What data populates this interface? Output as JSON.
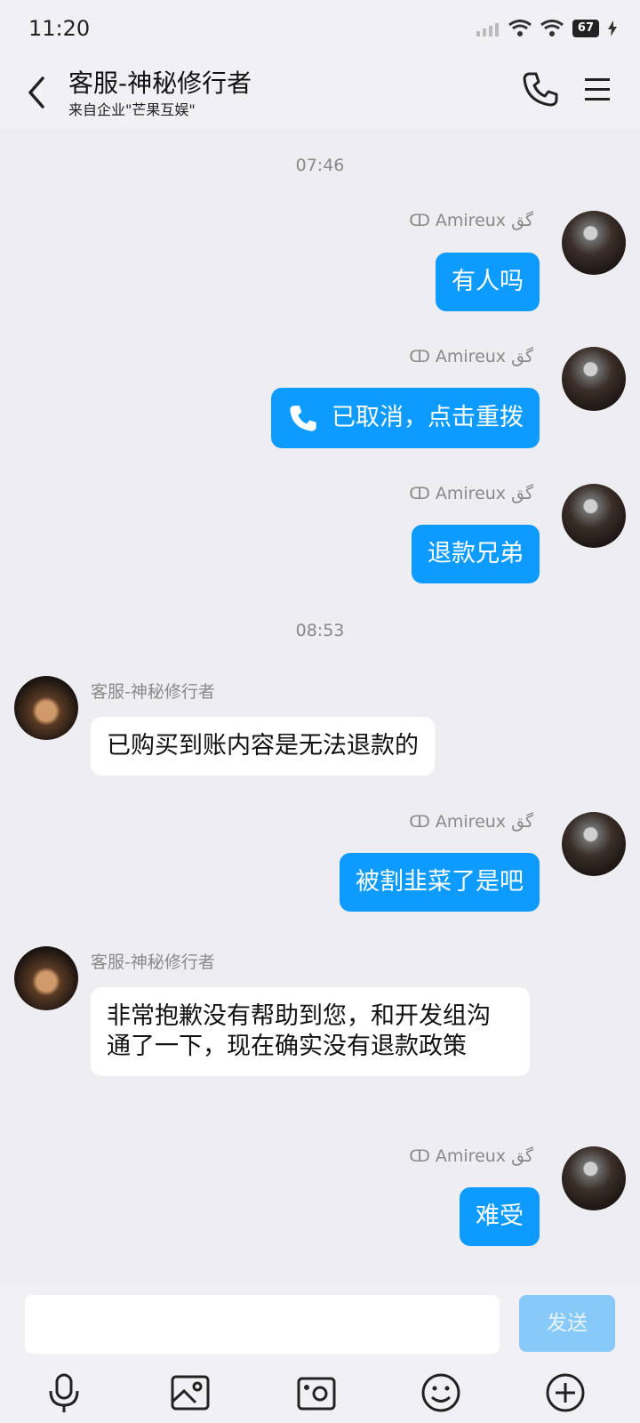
{
  "status_bar": {
    "time": "11:20",
    "battery": "67"
  },
  "header": {
    "title": "客服-神秘修行者",
    "subtitle": "来自企业\"芒果互娱\""
  },
  "timestamps": [
    "07:46",
    "08:53"
  ],
  "me_name": "ↀ Amireux گق",
  "agent_name": "客服-神秘修行者",
  "messages": [
    {
      "from": "me",
      "text": "有人吗"
    },
    {
      "from": "me",
      "text": "已取消，点击重拨",
      "type": "call"
    },
    {
      "from": "me",
      "text": "退款兄弟"
    },
    {
      "from": "agent",
      "text": "已购买到账内容是无法退款的"
    },
    {
      "from": "me",
      "text": "被割韭菜了是吧"
    },
    {
      "from": "agent",
      "text": "非常抱歉没有帮助到您，和开发组沟通了一下，现在确实没有退款政策"
    },
    {
      "from": "me",
      "text": "难受"
    }
  ],
  "input": {
    "value": "",
    "send_label": "发送"
  },
  "toolbar": [
    "microphone-icon",
    "image-icon",
    "camera-icon",
    "emoji-icon",
    "plus-icon"
  ],
  "colors": {
    "my_bubble": "#0e9bff",
    "their_bubble": "#ffffff",
    "background": "#ededf2",
    "send_button": "#87c9f9"
  }
}
